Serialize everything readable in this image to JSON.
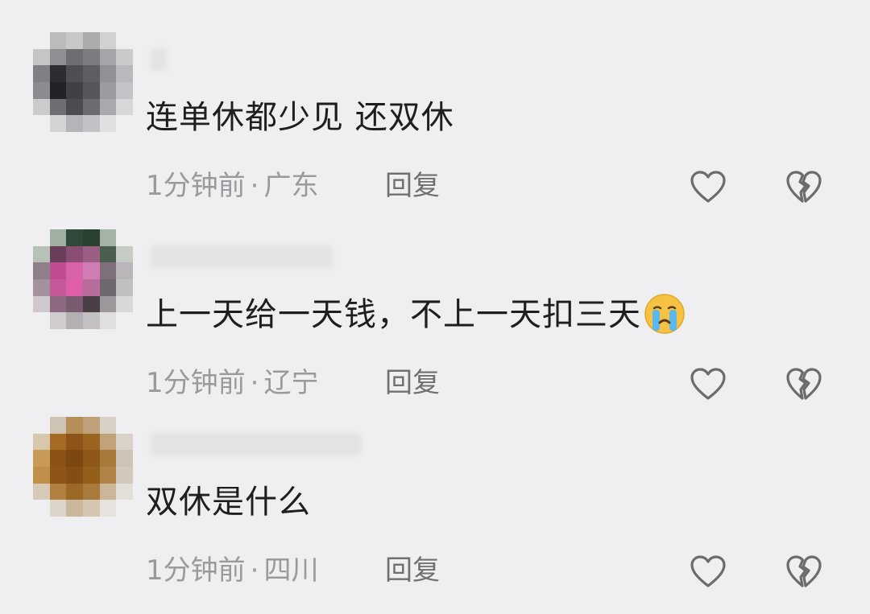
{
  "comments": [
    {
      "text": "连单休都少见 还双休",
      "time": "1分钟前",
      "location": "广东",
      "separator": "·",
      "reply_label": "回复",
      "has_emoji": false
    },
    {
      "text": "上一天给一天钱，不上一天扣三天",
      "time": "1分钟前",
      "location": "辽宁",
      "separator": "·",
      "reply_label": "回复",
      "has_emoji": true,
      "emoji": "crying-face"
    },
    {
      "text": "双休是什么",
      "time": "1分钟前",
      "location": "四川",
      "separator": "·",
      "reply_label": "回复",
      "has_emoji": false
    }
  ],
  "colors": {
    "background": "#efeff1",
    "text": "#1e1e1e",
    "meta": "#9a9a9e",
    "icon": "#6b6b70"
  }
}
